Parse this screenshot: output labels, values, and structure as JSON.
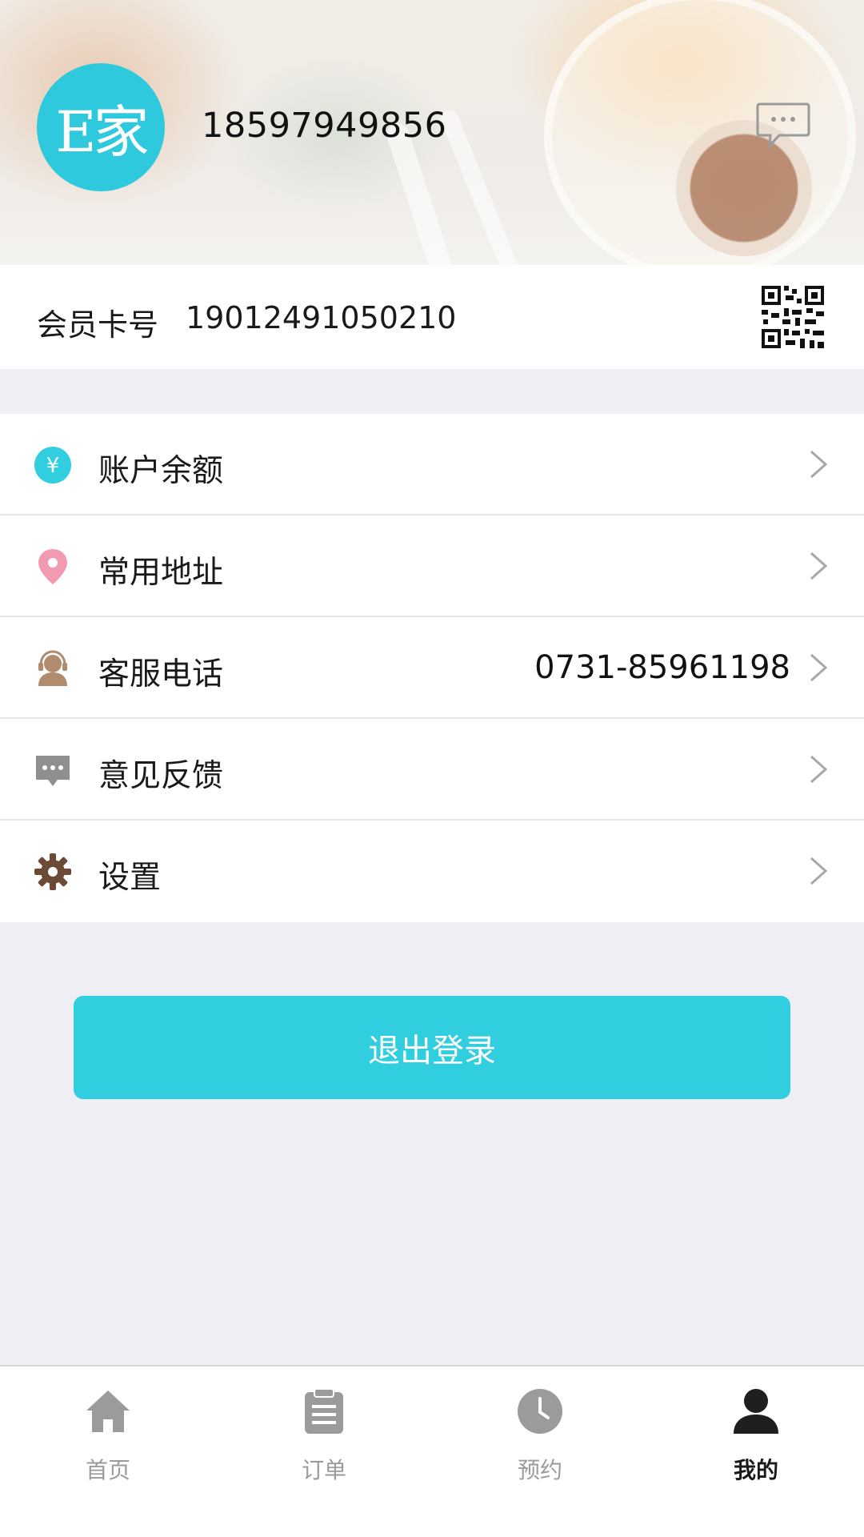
{
  "header": {
    "avatar_text": "E家",
    "phone": "18597949856"
  },
  "member": {
    "label": "会员卡号",
    "number": "19012491050210"
  },
  "menu": [
    {
      "label": "账户余额",
      "value": "",
      "icon": "yen-icon"
    },
    {
      "label": "常用地址",
      "value": "",
      "icon": "location-pin-icon"
    },
    {
      "label": "客服电话",
      "value": "0731-85961198",
      "icon": "customer-service-icon"
    },
    {
      "label": "意见反馈",
      "value": "",
      "icon": "feedback-icon"
    },
    {
      "label": "设置",
      "value": "",
      "icon": "gear-icon"
    }
  ],
  "logout_label": "退出登录",
  "tabs": [
    {
      "label": "首页",
      "icon": "home-icon",
      "active": false
    },
    {
      "label": "订单",
      "icon": "clipboard-icon",
      "active": false
    },
    {
      "label": "预约",
      "icon": "clock-icon",
      "active": false
    },
    {
      "label": "我的",
      "icon": "user-icon",
      "active": true
    }
  ],
  "colors": {
    "accent": "#31cee0",
    "background": "#efeef4",
    "tab_inactive": "#9b9b9b",
    "tab_active": "#1a1a1a"
  }
}
